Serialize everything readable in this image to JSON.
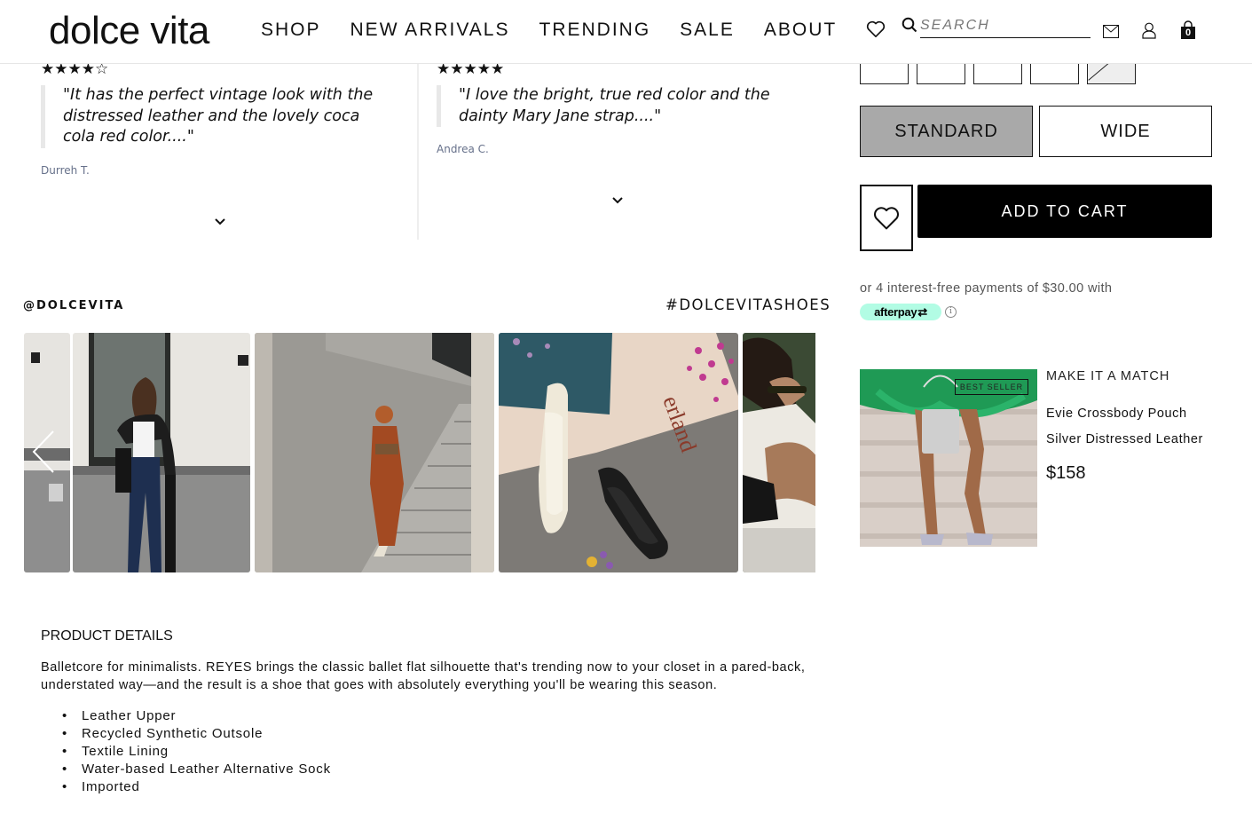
{
  "header": {
    "logo": "dolce vita",
    "nav": [
      "SHOP",
      "NEW ARRIVALS",
      "TRENDING",
      "SALE",
      "ABOUT"
    ],
    "search_placeholder": "SEARCH",
    "cart_count": "0",
    "icons": [
      "heart-icon",
      "search-icon",
      "mail-icon",
      "user-icon",
      "bag-icon"
    ]
  },
  "reviews": [
    {
      "rating": 4,
      "stars": "★★★★☆",
      "quote": "\"It has the perfect vintage look with the distressed leather and the lovely coca cola red color....\"",
      "author": "Durreh T."
    },
    {
      "rating": 5,
      "stars": "★★★★★",
      "quote": "\"I love the bright, true red color and the dainty Mary Jane strap....\"",
      "author": "Andrea C."
    }
  ],
  "product": {
    "width_options": [
      "STANDARD",
      "WIDE"
    ],
    "selected_width": "STANDARD",
    "add_to_cart": "ADD TO CART",
    "afterpay_text": "or 4 interest-free payments of $30.00 with",
    "afterpay_brand": "afterpay",
    "afterpay_color": "#b2fce4",
    "info": "ⓘ"
  },
  "match": {
    "title": "MAKE IT A MATCH",
    "badge": "BEST SELLER",
    "name": "Evie Crossbody Pouch",
    "color": "Silver Distressed Leather",
    "price": "$158"
  },
  "ugc": {
    "handle": "@DOLCEVITA",
    "hashtag": "#DOLCEVITASHOES",
    "tiles": [
      "woman in leather jacket by column",
      "woman in rust satin dress on stairs",
      "cream and black mary jane flats on books",
      "woman in white shirt and sunglasses"
    ]
  },
  "details": {
    "title": "PRODUCT DETAILS",
    "description": "Balletcore for minimalists. REYES brings the classic ballet flat silhouette that's trending now to your closet in a pared-back, understated way—and the result is a shoe that goes with absolutely everything you'll be wearing this season.",
    "features": [
      "Leather Upper",
      "Recycled Synthetic Outsole",
      "Textile Lining",
      "Water-based Leather Alternative Sock",
      "Imported"
    ]
  }
}
